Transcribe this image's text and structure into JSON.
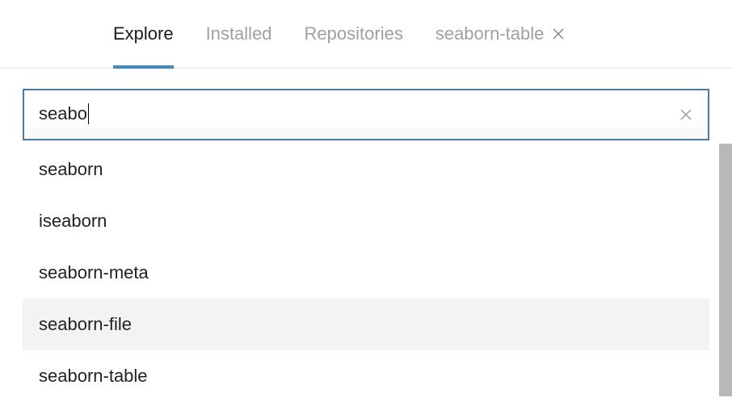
{
  "tabs": {
    "explore": "Explore",
    "installed": "Installed",
    "repositories": "Repositories",
    "extra_tab": "seaborn-table"
  },
  "search": {
    "value": "seabo"
  },
  "results": [
    {
      "label": "seaborn",
      "hovered": false
    },
    {
      "label": "iseaborn",
      "hovered": false
    },
    {
      "label": "seaborn-meta",
      "hovered": false
    },
    {
      "label": "seaborn-file",
      "hovered": true
    },
    {
      "label": "seaborn-table",
      "hovered": false
    }
  ]
}
